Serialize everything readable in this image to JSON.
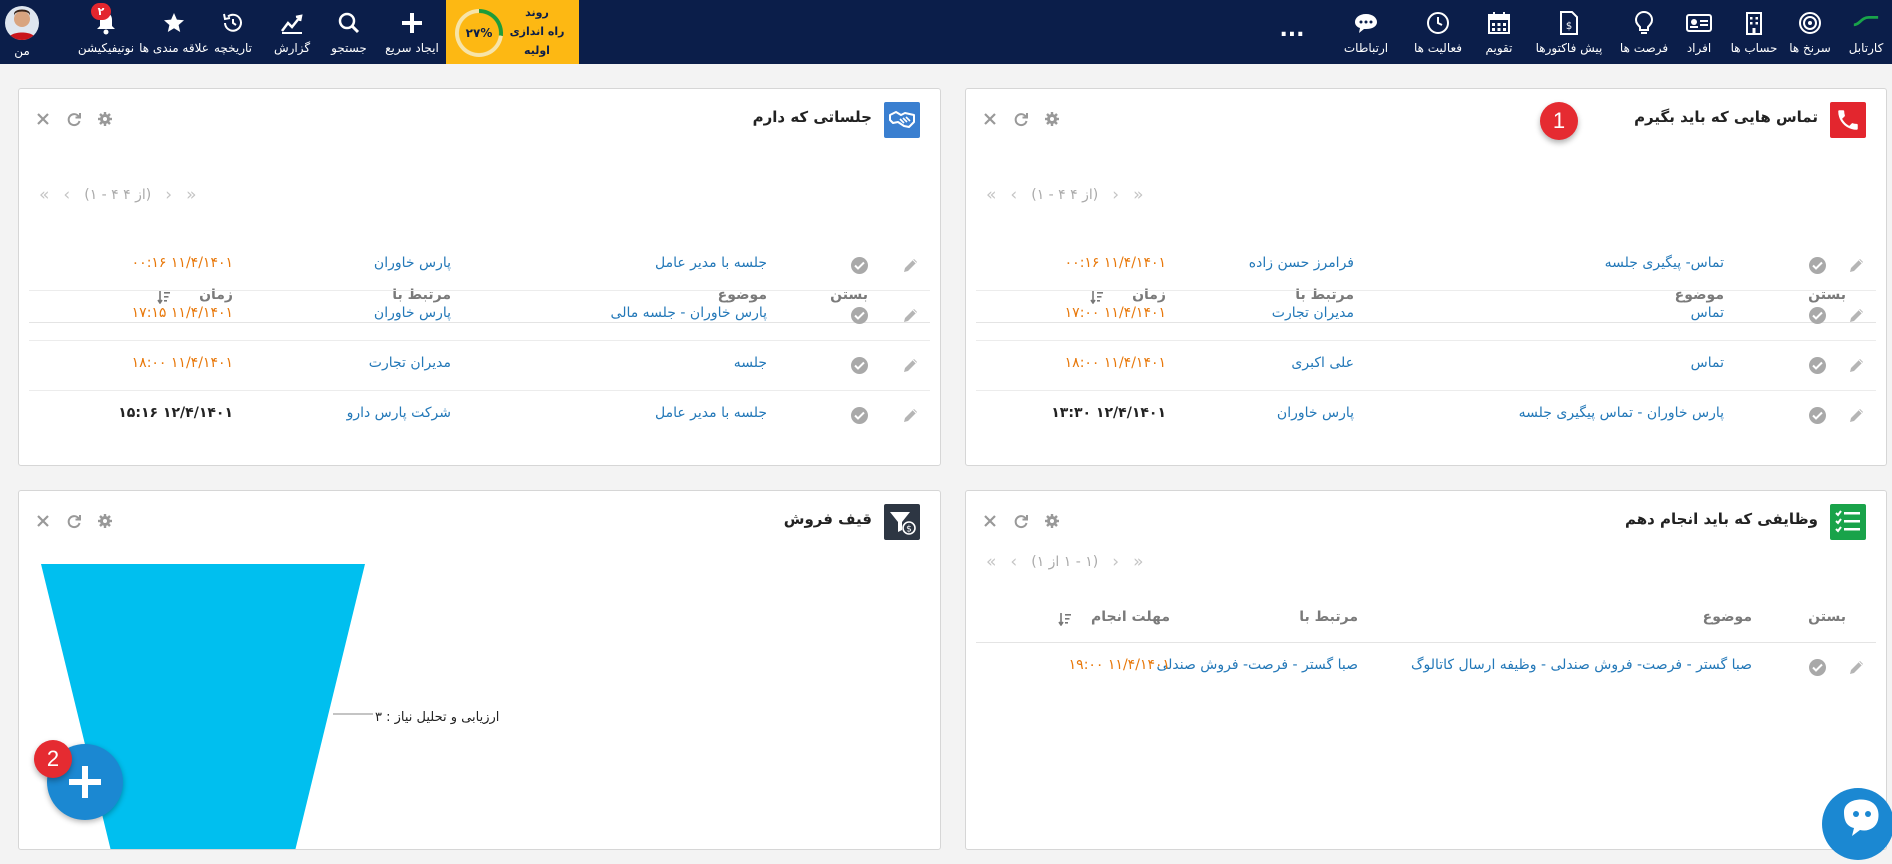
{
  "topbar": {
    "items_right": [
      {
        "id": "cartable",
        "label": "کارتابل",
        "icon": "cartable-icon"
      },
      {
        "id": "shortcuts",
        "label": "سرنخ ها",
        "icon": "target-icon"
      },
      {
        "id": "accounts",
        "label": "حساب ها",
        "icon": "building-icon"
      },
      {
        "id": "people",
        "label": "افراد",
        "icon": "id-card-icon"
      },
      {
        "id": "opportunities",
        "label": "فرصت ها",
        "icon": "lightbulb-icon"
      },
      {
        "id": "invoices",
        "label": "پیش فاکتورها",
        "icon": "invoice-icon"
      },
      {
        "id": "calendar",
        "label": "تقویم",
        "icon": "calendar-icon"
      },
      {
        "id": "activities",
        "label": "فعالیت ها",
        "icon": "clock-icon"
      },
      {
        "id": "communications",
        "label": "ارتباطات",
        "icon": "chat-icon"
      }
    ],
    "more_label": "...",
    "onboarding": {
      "percent": "٢٧%",
      "line1": "روند",
      "line2": "راه اندازی",
      "line3": "اولیه",
      "progress": 0.27
    },
    "items_left": [
      {
        "id": "quick-create",
        "label": "ایجاد سریع",
        "icon": "plus-icon"
      },
      {
        "id": "search",
        "label": "جستجو",
        "icon": "search-icon"
      },
      {
        "id": "report",
        "label": "گزارش",
        "icon": "chart-icon"
      },
      {
        "id": "history",
        "label": "تاریخچه",
        "icon": "history-icon"
      },
      {
        "id": "favorites",
        "label": "علاقه مندی ها",
        "icon": "star-icon"
      },
      {
        "id": "notifications",
        "label": "نوتیفیکیشن",
        "icon": "bell-icon"
      },
      {
        "id": "me",
        "label": "من",
        "icon": "avatar"
      }
    ],
    "notification_count": "٢"
  },
  "panels": {
    "calls": {
      "title": "تماس هایی که باید بگیرم",
      "pager": "(١ - ۴ از ۴)",
      "headers": {
        "close": "بستن",
        "subject": "موضوع",
        "related": "مرتبط با",
        "time": "زمان"
      },
      "rows": [
        {
          "subject": "تماس- پیگیری جلسه",
          "related": "فرامرز حسن زاده",
          "time": "١۴٠١/۴/١١ ١۶:٠٠",
          "overdue": true
        },
        {
          "subject": "تماس",
          "related": "مدیران تجارت",
          "time": "١۴٠١/۴/١١ ١٧:٠٠",
          "overdue": true
        },
        {
          "subject": "تماس",
          "related": "علی اکبری",
          "time": "١۴٠١/۴/١١ ١٨:٠٠",
          "overdue": true
        },
        {
          "subject": "پارس خاوران - تماس پیگیری جلسه",
          "related": "پارس خاوران",
          "time": "١۴٠١/۴/١٢ ١٣:٣٠",
          "overdue": false
        }
      ]
    },
    "meetings": {
      "title": "جلساتی که دارم",
      "pager": "(١ - ۴ از ۴)",
      "headers": {
        "close": "بستن",
        "subject": "موضوع",
        "related": "مرتبط با",
        "time": "زمان"
      },
      "rows": [
        {
          "subject": "جلسه با مدیر عامل",
          "related": "پارس خاوران",
          "time": "١۴٠١/۴/١١ ١۶:٠٠",
          "overdue": true
        },
        {
          "subject": "پارس خاوران - جلسه مالی",
          "related": "پارس خاوران",
          "time": "١۴٠١/۴/١١ ١٧:١۵",
          "overdue": true
        },
        {
          "subject": "جلسه",
          "related": "مدیران تجارت",
          "time": "١۴٠١/۴/١١ ١٨:٠٠",
          "overdue": true
        },
        {
          "subject": "جلسه با مدیر عامل",
          "related": "شرکت پارس دارو",
          "time": "١۴٠١/۴/١٢ ١۶:١۵",
          "overdue": false
        }
      ]
    },
    "tasks": {
      "title": "وظایفی که باید انجام دهم",
      "pager": "(١ - ١ از ١)",
      "headers": {
        "close": "بستن",
        "subject": "موضوع",
        "related": "مرتبط با",
        "time": "مهلت انجام"
      },
      "rows": [
        {
          "subject": "صبا گستر - فرصت- فروش صندلی - وظیفه ارسال کاتالوگ",
          "related": "صبا گستر - فرصت- فروش صندلی",
          "time": "١۴٠١/۴/١١ ١٩:٠٠",
          "overdue": true
        }
      ]
    },
    "funnel": {
      "title": "قیف فروش",
      "stage_label": "ارزیابی و تحلیل نیاز : ٣"
    }
  },
  "markers": {
    "m1": "1",
    "m2": "2"
  },
  "colors": {
    "nav_bg": "#0b1e4a",
    "onboarding": "#fdb813",
    "link": "#2378b8",
    "overdue": "#e8780a",
    "funnel": "#00bfef",
    "call_icon": "#e3262e",
    "meeting_icon": "#3a7fd0",
    "task_icon": "#19a34a",
    "funnel_icon": "#2d3643"
  }
}
